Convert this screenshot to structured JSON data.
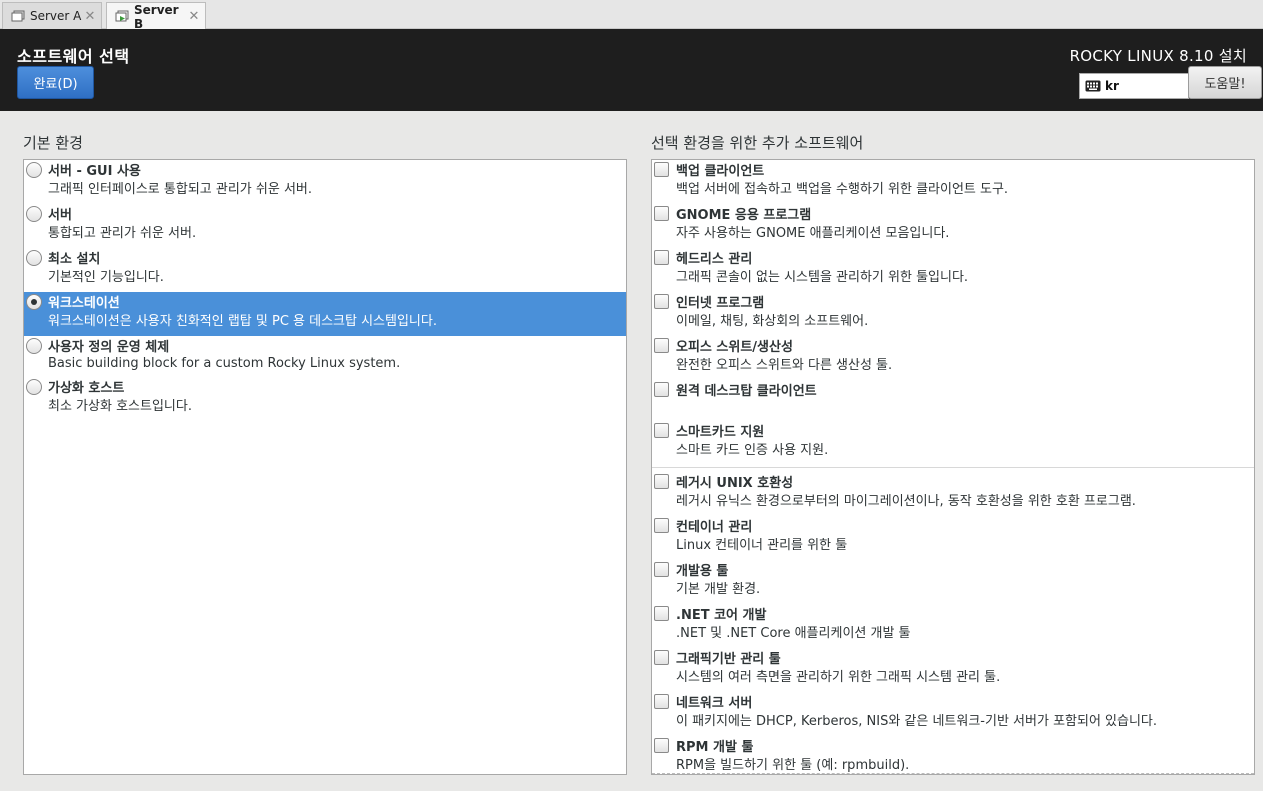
{
  "tabs": [
    {
      "label": "Server A",
      "active": false
    },
    {
      "label": "Server B",
      "active": true
    }
  ],
  "header": {
    "page_title": "소프트웨어 선택",
    "done_label": "완료(D)",
    "product_title": "ROCKY LINUX 8.10 설치",
    "keyboard_layout": "kr",
    "help_label": "도움말!",
    "accent_color": "#4a90d9"
  },
  "base_env": {
    "heading": "기본 환경",
    "items": [
      {
        "name": "서버 - GUI 사용",
        "desc": "그래픽 인터페이스로 통합되고 관리가 쉬운 서버.",
        "selected": false
      },
      {
        "name": "서버",
        "desc": "통합되고 관리가 쉬운 서버.",
        "selected": false
      },
      {
        "name": "최소 설치",
        "desc": "기본적인 기능입니다.",
        "selected": false
      },
      {
        "name": "워크스테이션",
        "desc": "워크스테이션은 사용자 친화적인 랩탑 및 PC 용 데스크탑 시스템입니다.",
        "selected": true
      },
      {
        "name": "사용자 정의 운영 체제",
        "desc": "Basic building block for a custom Rocky Linux system.",
        "selected": false
      },
      {
        "name": "가상화 호스트",
        "desc": "최소 가상화 호스트입니다.",
        "selected": false
      }
    ]
  },
  "addons": {
    "heading": "선택 환경을 위한 추가 소프트웨어",
    "items": [
      {
        "name": "백업 클라이언트",
        "desc": "백업 서버에 접속하고 백업을 수행하기 위한 클라이언트 도구.",
        "checked": false
      },
      {
        "name": "GNOME 응용 프로그램",
        "desc": "자주 사용하는 GNOME 애플리케이션 모음입니다.",
        "checked": false
      },
      {
        "name": "헤드리스 관리",
        "desc": "그래픽 콘솔이 없는 시스템을 관리하기 위한 툴입니다.",
        "checked": false
      },
      {
        "name": "인터넷 프로그램",
        "desc": "이메일, 채팅, 화상회의 소프트웨어.",
        "checked": false
      },
      {
        "name": "오피스 스위트/생산성",
        "desc": "완전한 오피스 스위트와 다른 생산성 툴.",
        "checked": false
      },
      {
        "name": "원격 데스크탑 클라이언트",
        "desc": "",
        "checked": false
      },
      {
        "name": "스마트카드 지원",
        "desc": "스마트 카드 인증 사용 지원.",
        "checked": false
      },
      {
        "name": "레거시 UNIX 호환성",
        "desc": "레거시 유닉스 환경으로부터의 마이그레이션이나, 동작 호환성을 위한 호환 프로그램.",
        "checked": false
      },
      {
        "name": "컨테이너 관리",
        "desc": "Linux 컨테이너 관리를 위한 툴",
        "checked": false
      },
      {
        "name": "개발용 툴",
        "desc": "기본 개발 환경.",
        "checked": false
      },
      {
        "name": ".NET 코어 개발",
        "desc": ".NET 및 .NET Core 애플리케이션 개발 툴",
        "checked": false
      },
      {
        "name": "그래픽기반 관리 툴",
        "desc": "시스템의 여러 측면을 관리하기 위한 그래픽 시스템 관리 툴.",
        "checked": false
      },
      {
        "name": "네트워크 서버",
        "desc": "이 패키지에는 DHCP, Kerberos, NIS와 같은 네트워크-기반 서버가 포함되어 있습니다.",
        "checked": false
      },
      {
        "name": "RPM 개발 툴",
        "desc": "RPM을 빌드하기 위한 툴 (예: rpmbuild).",
        "checked": false
      }
    ]
  }
}
